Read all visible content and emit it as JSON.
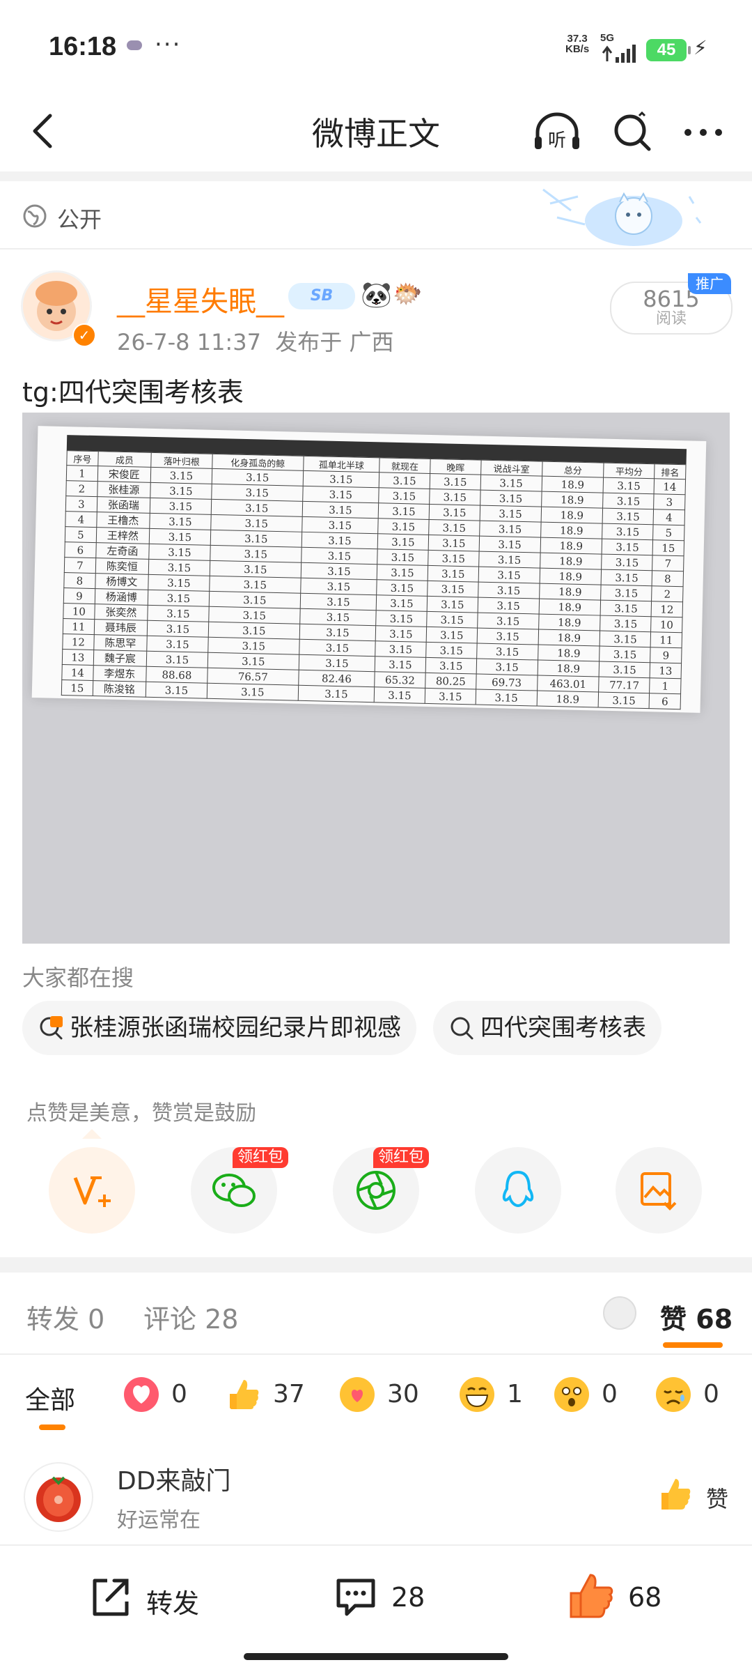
{
  "status_bar": {
    "time": "16:18",
    "dots": "···",
    "net_speed": "37.3",
    "net_unit": "KB/s",
    "network": "5G",
    "battery": "45"
  },
  "header": {
    "title": "微博正文"
  },
  "visibility": {
    "label": "公开"
  },
  "post": {
    "author": "__星星失眠__",
    "level_badge": "SB",
    "meta_date": "26-7-8 11:37",
    "meta_location": "发布于 广西",
    "read_count": "8615",
    "read_label": "阅读",
    "promo_tag": "推广",
    "text": "tg:四代突围考核表"
  },
  "photo_table": {
    "headers": [
      "序号",
      "成员",
      "落叶归根",
      "化身孤岛的鲸",
      "孤单北半球",
      "就现在",
      "晚晖",
      "说战斗室",
      "总分",
      "平均分",
      "排名"
    ],
    "rows": [
      [
        "1",
        "宋俊匠",
        "3.15",
        "3.15",
        "3.15",
        "3.15",
        "3.15",
        "3.15",
        "18.9",
        "3.15",
        "14"
      ],
      [
        "2",
        "张桂源",
        "3.15",
        "3.15",
        "3.15",
        "3.15",
        "3.15",
        "3.15",
        "18.9",
        "3.15",
        "3"
      ],
      [
        "3",
        "张函瑞",
        "3.15",
        "3.15",
        "3.15",
        "3.15",
        "3.15",
        "3.15",
        "18.9",
        "3.15",
        "4"
      ],
      [
        "4",
        "王橹杰",
        "3.15",
        "3.15",
        "3.15",
        "3.15",
        "3.15",
        "3.15",
        "18.9",
        "3.15",
        "5"
      ],
      [
        "5",
        "王梓然",
        "3.15",
        "3.15",
        "3.15",
        "3.15",
        "3.15",
        "3.15",
        "18.9",
        "3.15",
        "15"
      ],
      [
        "6",
        "左奇函",
        "3.15",
        "3.15",
        "3.15",
        "3.15",
        "3.15",
        "3.15",
        "18.9",
        "3.15",
        "7"
      ],
      [
        "7",
        "陈奕恒",
        "3.15",
        "3.15",
        "3.15",
        "3.15",
        "3.15",
        "3.15",
        "18.9",
        "3.15",
        "8"
      ],
      [
        "8",
        "杨博文",
        "3.15",
        "3.15",
        "3.15",
        "3.15",
        "3.15",
        "3.15",
        "18.9",
        "3.15",
        "2"
      ],
      [
        "9",
        "杨涵博",
        "3.15",
        "3.15",
        "3.15",
        "3.15",
        "3.15",
        "3.15",
        "18.9",
        "3.15",
        "12"
      ],
      [
        "10",
        "张奕然",
        "3.15",
        "3.15",
        "3.15",
        "3.15",
        "3.15",
        "3.15",
        "18.9",
        "3.15",
        "10"
      ],
      [
        "11",
        "聂玮辰",
        "3.15",
        "3.15",
        "3.15",
        "3.15",
        "3.15",
        "3.15",
        "18.9",
        "3.15",
        "11"
      ],
      [
        "12",
        "陈思罕",
        "3.15",
        "3.15",
        "3.15",
        "3.15",
        "3.15",
        "3.15",
        "18.9",
        "3.15",
        "9"
      ],
      [
        "13",
        "魏子宸",
        "3.15",
        "3.15",
        "3.15",
        "3.15",
        "3.15",
        "3.15",
        "18.9",
        "3.15",
        "13"
      ],
      [
        "14",
        "李煜东",
        "88.68",
        "76.57",
        "82.46",
        "65.32",
        "80.25",
        "69.73",
        "463.01",
        "77.17",
        "1"
      ],
      [
        "15",
        "陈浚铭",
        "3.15",
        "3.15",
        "3.15",
        "3.15",
        "3.15",
        "3.15",
        "18.9",
        "3.15",
        "6"
      ]
    ]
  },
  "search_section": {
    "label": "大家都在搜",
    "chip1": "张桂源张函瑞校园纪录片即视感",
    "chip2": "四代突围考核表"
  },
  "reward": {
    "tip": "点赞是美意，赞赏是鼓励",
    "red_packet_label": "领红包"
  },
  "tabs": {
    "repost_label": "转发",
    "repost_count": "0",
    "comment_label": "评论",
    "comment_count": "28",
    "like_label": "赞",
    "like_count": "68"
  },
  "reactions": {
    "all_label": "全部",
    "items": [
      {
        "name": "heart",
        "count": "0"
      },
      {
        "name": "thumbs-up",
        "count": "37"
      },
      {
        "name": "heart-face",
        "count": "30"
      },
      {
        "name": "laugh",
        "count": "1"
      },
      {
        "name": "surprised",
        "count": "0"
      },
      {
        "name": "sad",
        "count": "0"
      }
    ]
  },
  "liker": {
    "name": "DD来敲门",
    "sub": "好运常在",
    "action": "赞"
  },
  "bottom_bar": {
    "repost": "转发",
    "comments": "28",
    "likes": "68"
  },
  "colors": {
    "accent": "#ff8200",
    "author": "#ff7b00",
    "red_packet": "#ff3b30",
    "promo": "#3b8cff"
  }
}
